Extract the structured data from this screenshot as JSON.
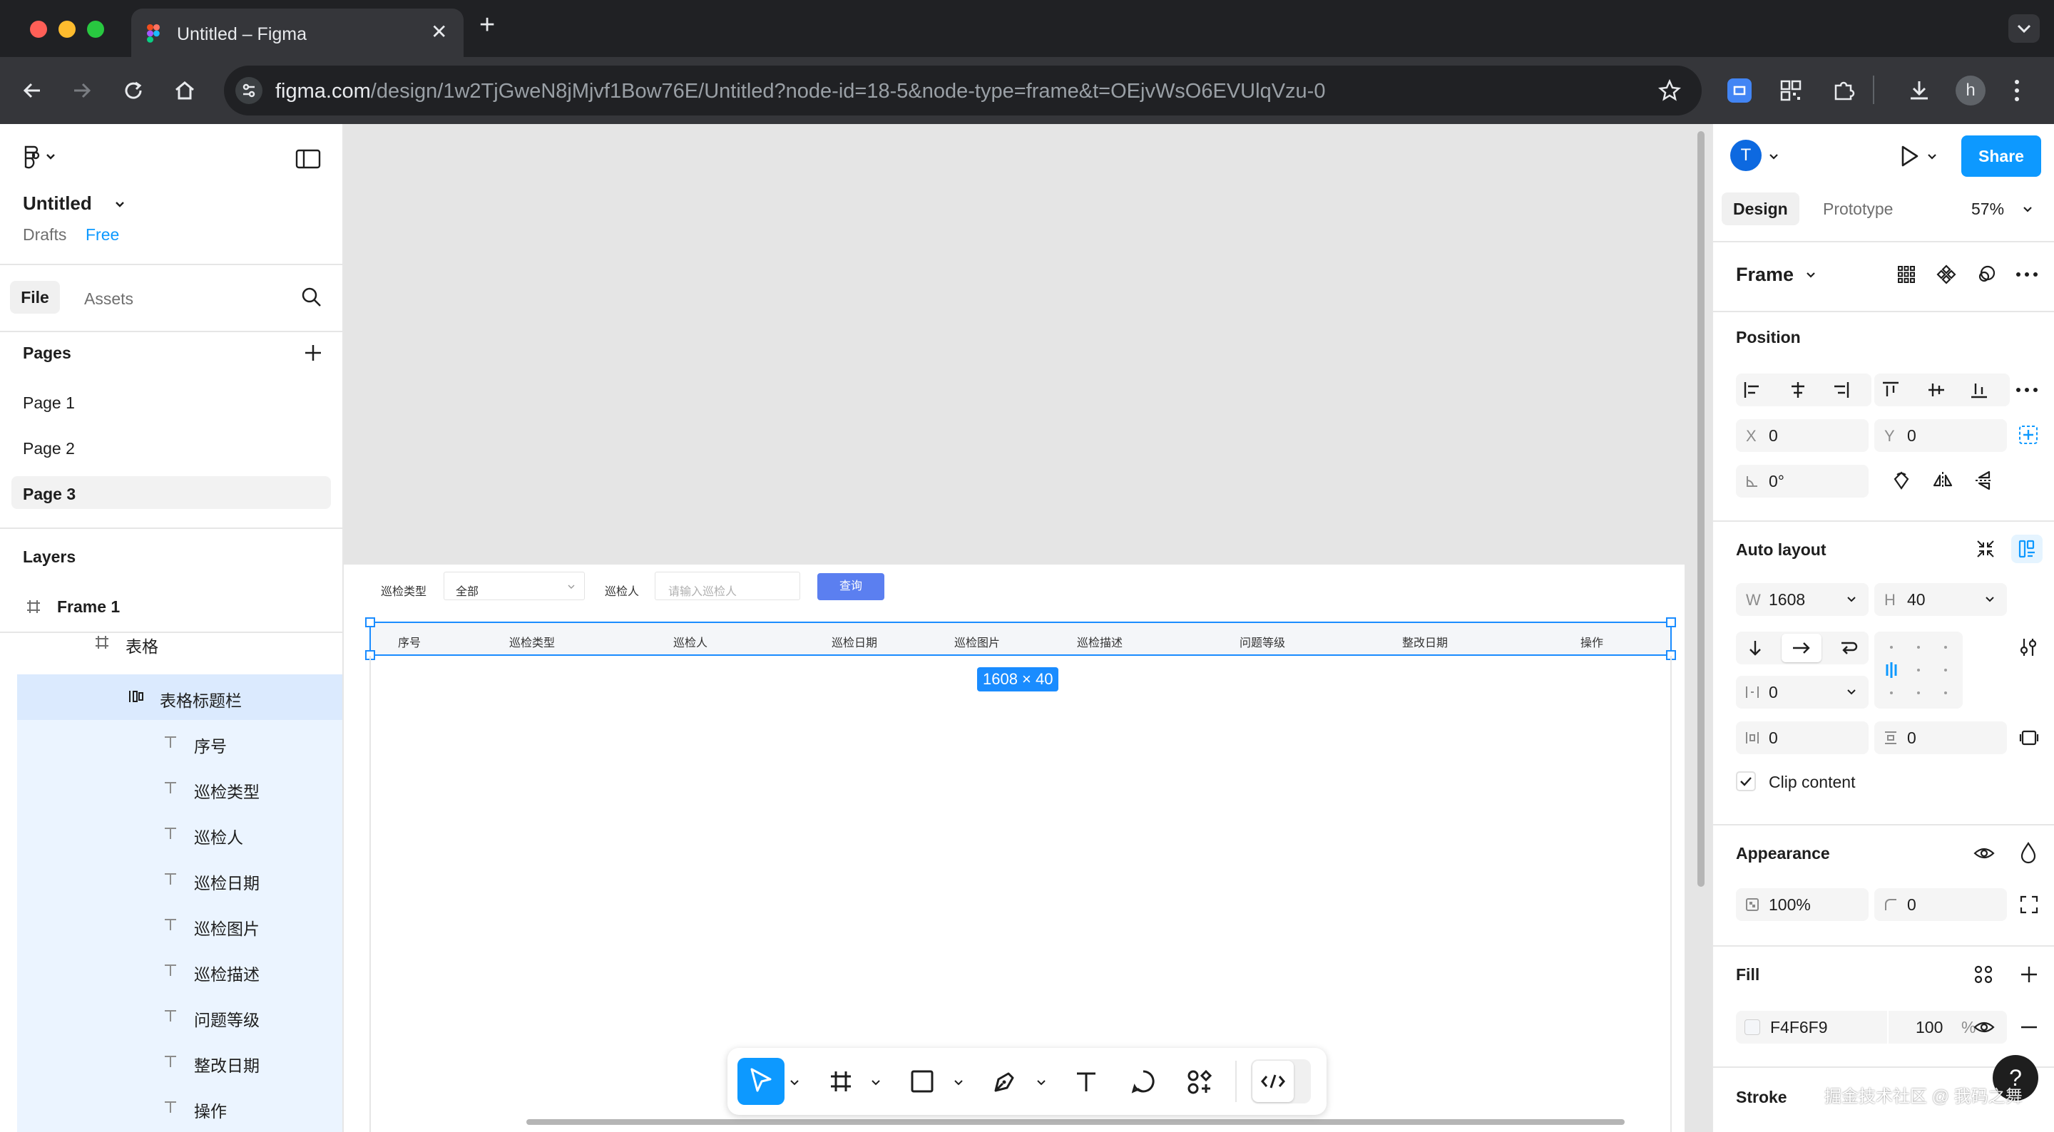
{
  "browser": {
    "tab_title": "Untitled – Figma",
    "url_host": "figma.com",
    "url_path": "/design/1w2TjGweN8jMjvf1Bow76E/Untitled?node-id=18-5&node-type=frame&t=OEjvWsO6EVUlqVzu-0",
    "profile_initial": "h"
  },
  "file": {
    "name": "Untitled",
    "location": "Drafts",
    "plan": "Free"
  },
  "left_tabs": {
    "file": "File",
    "assets": "Assets"
  },
  "pages": {
    "header": "Pages",
    "items": [
      "Page 1",
      "Page 2",
      "Page 3"
    ],
    "selected": "Page 3"
  },
  "layers": {
    "header": "Layers",
    "frame": "Frame 1",
    "table": "表格",
    "header_bar": "表格标题栏",
    "text_items": [
      "序号",
      "巡检类型",
      "巡检人",
      "巡检日期",
      "巡检图片",
      "巡检描述",
      "问题等级",
      "整改日期",
      "操作"
    ]
  },
  "canvas_content": {
    "filter_type_label": "巡检类型",
    "filter_type_value": "全部",
    "filter_person_label": "巡检人",
    "filter_person_placeholder": "请输入巡检人",
    "query_button": "查询",
    "columns": [
      "序号",
      "巡检类型",
      "巡检人",
      "巡检日期",
      "巡检图片",
      "巡检描述",
      "问题等级",
      "整改日期",
      "操作"
    ],
    "size_badge": "1608 × 40"
  },
  "right_panel": {
    "user_initial": "T",
    "share": "Share",
    "tab_design": "Design",
    "tab_prototype": "Prototype",
    "zoom": "57%",
    "frame_label": "Frame",
    "position_header": "Position",
    "x_label": "X",
    "x": "0",
    "y_label": "Y",
    "y": "0",
    "rotation": "0°",
    "auto_layout_header": "Auto layout",
    "w_label": "W",
    "w": "1608",
    "h_label": "H",
    "h": "40",
    "gap": "0",
    "pad_h": "0",
    "pad_v": "0",
    "clip_content": "Clip content",
    "appearance_header": "Appearance",
    "opacity": "100%",
    "radius": "0",
    "fill_header": "Fill",
    "fill_hex": "F4F6F9",
    "fill_opacity": "100",
    "percent": "%",
    "stroke_header": "Stroke"
  },
  "watermark": "掘金技术社区 @ 我码之舞",
  "colors": {
    "accent": "#0d99ff",
    "selection": "#1a8cff",
    "query_button": "#5b7ff0",
    "fill_swatch": "#F4F6F9"
  }
}
